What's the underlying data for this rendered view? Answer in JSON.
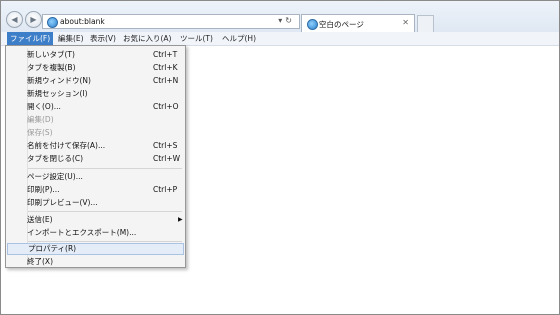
{
  "browser": {
    "address_url": "about:blank",
    "tab_title": "空白のページ",
    "back_icon": "back-arrow-icon",
    "forward_icon": "forward-arrow-icon"
  },
  "menubar": {
    "items": [
      {
        "label": "ファイル(F)"
      },
      {
        "label": "編集(E)"
      },
      {
        "label": "表示(V)"
      },
      {
        "label": "お気に入り(A)"
      },
      {
        "label": "ツール(T)"
      },
      {
        "label": "ヘルプ(H)"
      }
    ]
  },
  "file_menu": {
    "items": [
      {
        "label": "新しいタブ(T)",
        "shortcut": "Ctrl+T"
      },
      {
        "label": "タブを複製(B)",
        "shortcut": "Ctrl+K"
      },
      {
        "label": "新規ウィンドウ(N)",
        "shortcut": "Ctrl+N"
      },
      {
        "label": "新規セッション(I)",
        "shortcut": ""
      },
      {
        "label": "開く(O)...",
        "shortcut": "Ctrl+O"
      },
      {
        "label": "編集(D)",
        "shortcut": ""
      },
      {
        "label": "保存(S)",
        "shortcut": ""
      },
      {
        "label": "名前を付けて保存(A)...",
        "shortcut": "Ctrl+S"
      },
      {
        "label": "タブを閉じる(C)",
        "shortcut": "Ctrl+W"
      },
      {
        "label": "ページ設定(U)...",
        "shortcut": ""
      },
      {
        "label": "印刷(P)...",
        "shortcut": "Ctrl+P"
      },
      {
        "label": "印刷プレビュー(V)...",
        "shortcut": ""
      },
      {
        "label": "送信(E)",
        "shortcut": ""
      },
      {
        "label": "インポートとエクスポート(M)...",
        "shortcut": ""
      },
      {
        "label": "プロパティ(R)",
        "shortcut": ""
      },
      {
        "label": "終了(X)",
        "shortcut": ""
      }
    ]
  }
}
